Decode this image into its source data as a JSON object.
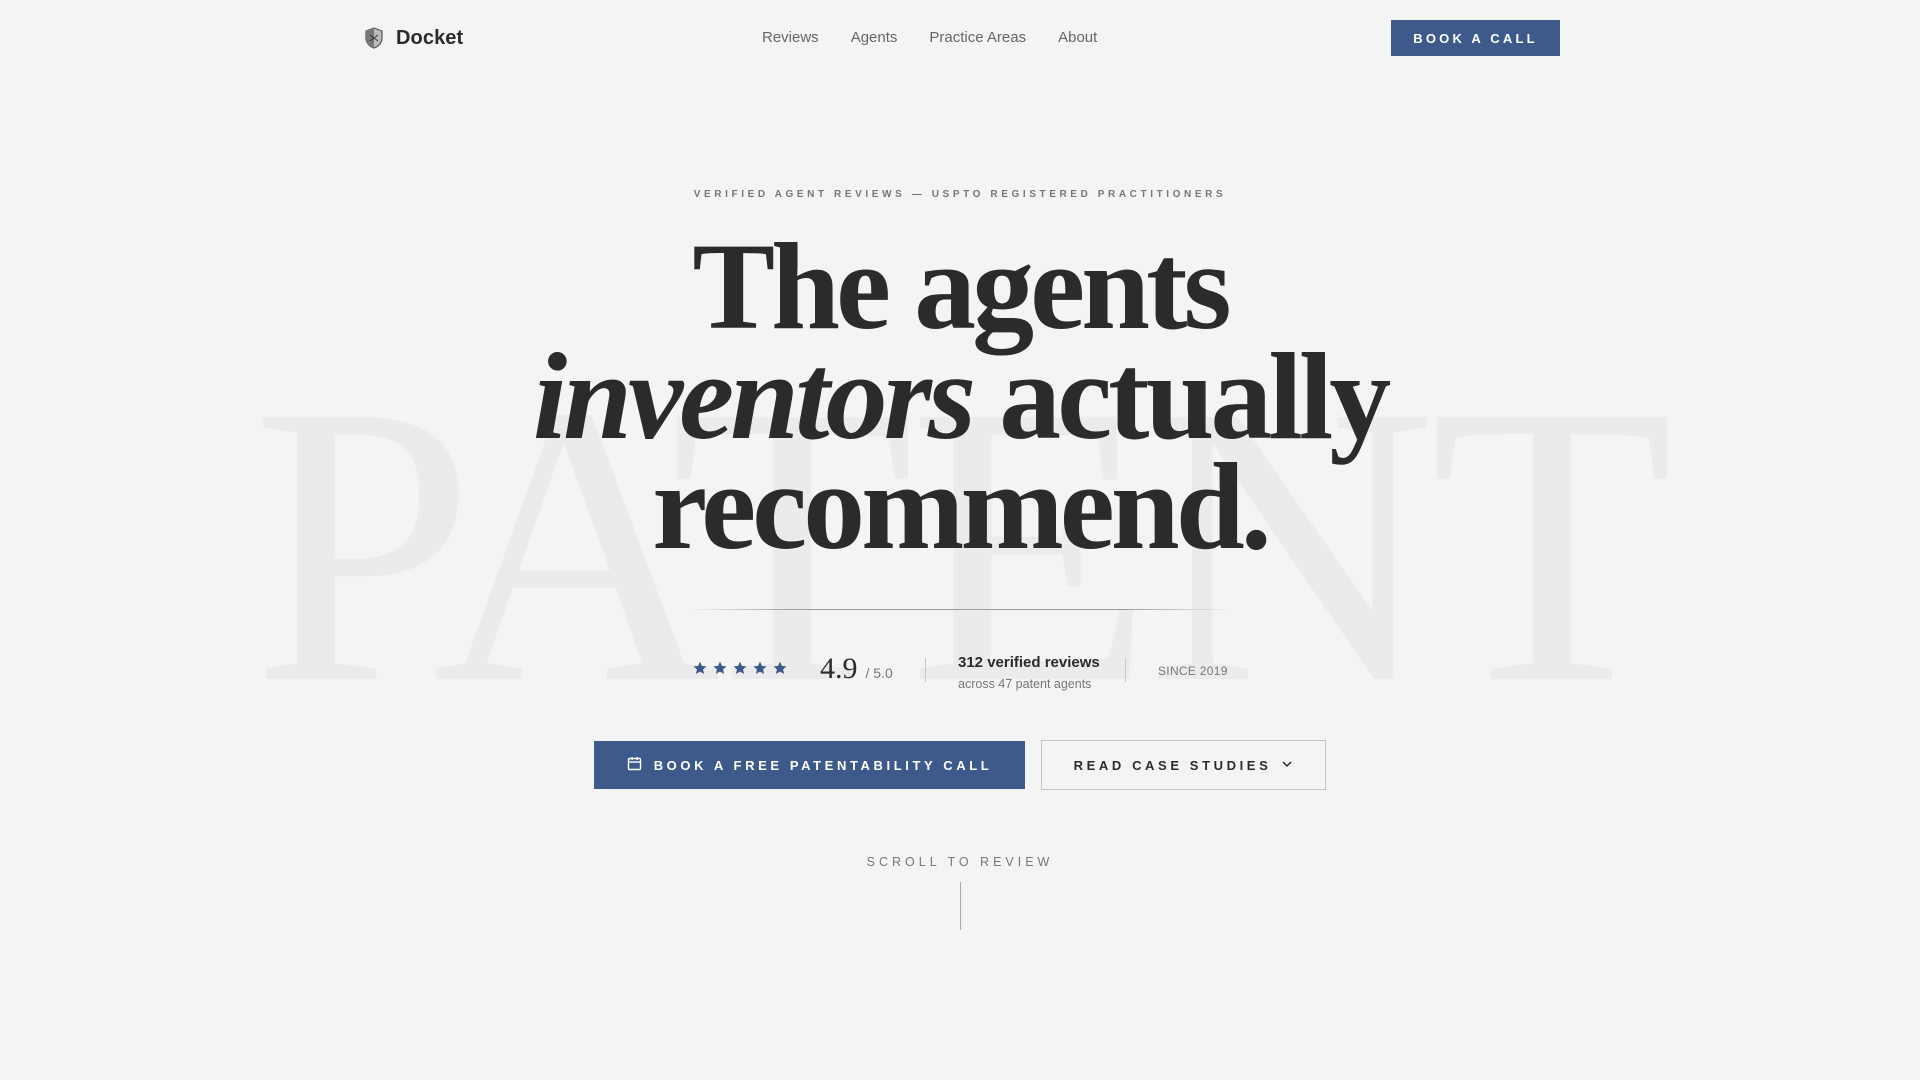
{
  "header": {
    "brand_name": "Docket",
    "brand_icon": "shield-icon",
    "nav": [
      {
        "label": "Reviews"
      },
      {
        "label": "Agents"
      },
      {
        "label": "Practice Areas"
      },
      {
        "label": "About"
      }
    ],
    "cta_label": "BOOK A CALL"
  },
  "hero": {
    "watermark": "PATENT",
    "eyebrow": "VERIFIED AGENT REVIEWS — USPTO REGISTERED PRACTITIONERS",
    "headline_line1": "The agents",
    "headline_italic": "inventors",
    "headline_line2_rest": " actually",
    "headline_line3": "recommend."
  },
  "stats": {
    "stars_count": 5,
    "rating_value": "4.9",
    "rating_max": "/ 5.0",
    "reviews_count": "312 verified reviews",
    "reviews_sub": "across 47 patent agents",
    "since": "SINCE 2019"
  },
  "cta": {
    "primary_label": "BOOK A FREE PATENTABILITY CALL",
    "primary_icon": "calendar-icon",
    "secondary_label": "READ CASE STUDIES",
    "secondary_icon": "chevron-down-icon"
  },
  "scroll": {
    "label": "SCROLL TO REVIEW"
  },
  "colors": {
    "accent": "#3d5a8a",
    "background": "#f4f4f4",
    "text": "#2b2b2b",
    "muted": "#777777",
    "watermark": "#ebebeb"
  }
}
